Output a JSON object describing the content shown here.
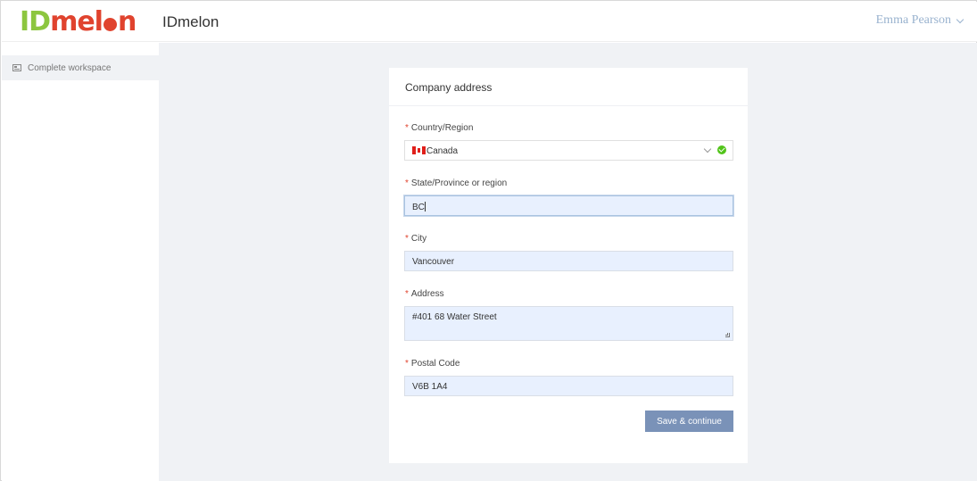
{
  "header": {
    "logo_text_1": "ID",
    "logo_text_2": "mel",
    "logo_text_3": "n",
    "app_title": "IDmelon",
    "user_name": "Emma Pearson"
  },
  "sidebar": {
    "items": [
      {
        "label": "Complete workspace",
        "icon": "workspace-icon",
        "active": true
      }
    ]
  },
  "form": {
    "title": "Company address",
    "required_mark": "*",
    "fields": {
      "country": {
        "label": "Country/Region",
        "value": "Canada",
        "icon": "canada-flag-icon",
        "valid": true
      },
      "state": {
        "label": "State/Province or region",
        "value": "BC"
      },
      "city": {
        "label": "City",
        "value": "Vancouver"
      },
      "address": {
        "label": "Address",
        "value": "#401 68 Water Street"
      },
      "postal": {
        "label": "Postal Code",
        "value": "V6B 1A4"
      }
    },
    "submit_label": "Save & continue"
  },
  "colors": {
    "brand_green": "#8cc63f",
    "brand_red": "#e0432e",
    "button": "#7a92b8",
    "autofill_bg": "#e8f0fe",
    "valid": "#52c41a"
  }
}
